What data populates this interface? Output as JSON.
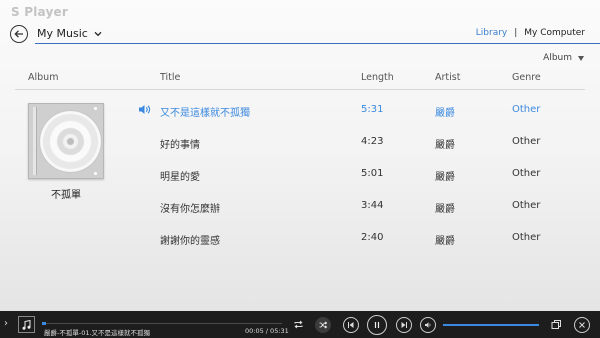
{
  "app": {
    "title": "S Player"
  },
  "header": {
    "source": "My Music",
    "nav_library": "Library",
    "nav_separator": "|",
    "nav_computer": "My Computer"
  },
  "sort": {
    "label": "Album"
  },
  "columns": {
    "album": "Album",
    "title": "Title",
    "length": "Length",
    "artist": "Artist",
    "genre": "Genre"
  },
  "album": {
    "title": "不孤單"
  },
  "tracks": [
    {
      "title": "又不是這樣就不孤獨",
      "length": "5:31",
      "artist": "嚴爵",
      "genre": "Other",
      "playing": true
    },
    {
      "title": "好的事情",
      "length": "4:23",
      "artist": "嚴爵",
      "genre": "Other",
      "playing": false
    },
    {
      "title": "明星的愛",
      "length": "5:01",
      "artist": "嚴爵",
      "genre": "Other",
      "playing": false
    },
    {
      "title": "沒有你怎麼辦",
      "length": "3:44",
      "artist": "嚴爵",
      "genre": "Other",
      "playing": false
    },
    {
      "title": "謝謝你的靈感",
      "length": "2:40",
      "artist": "嚴爵",
      "genre": "Other",
      "playing": false
    }
  ],
  "player": {
    "now_playing": "嚴爵-不孤單-01.又不是這樣就不孤獨",
    "time": "00:05 / 05:31",
    "progress": 0.016,
    "volume": 1.0,
    "shuffle_on": true
  },
  "icons": {
    "back": "arrow-left-circle-icon",
    "dropdown": "chevron-down-icon",
    "speaker": "speaker-icon",
    "note": "music-note-icon",
    "repeat": "repeat-icon",
    "shuffle": "shuffle-icon",
    "previous": "skip-previous-icon",
    "pause": "pause-icon",
    "next": "skip-next-icon",
    "volume": "volume-icon",
    "mini": "mini-player-icon",
    "close": "close-icon"
  },
  "colors": {
    "accent": "#3c8ae0",
    "player_bg": "#1d1d1d"
  }
}
